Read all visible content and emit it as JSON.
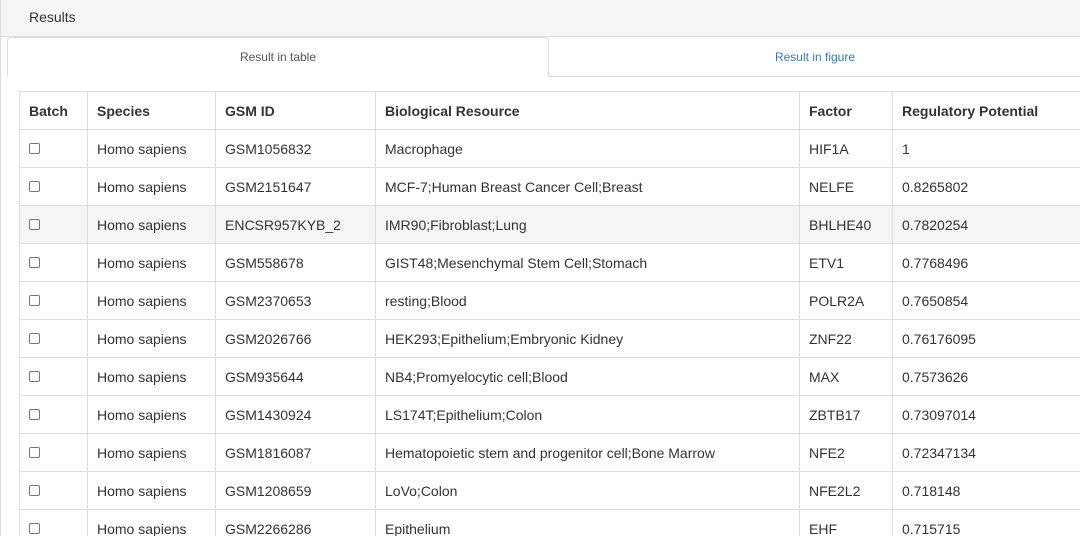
{
  "panel": {
    "heading": "Results"
  },
  "tabs": [
    {
      "label": "Result in table",
      "active": true
    },
    {
      "label": "Result in figure",
      "active": false
    }
  ],
  "colors": {
    "link": "#337ab7",
    "border": "#dddddd",
    "heading_bg": "#f5f5f5",
    "row_hover": "#f5f5f5"
  },
  "table": {
    "columns": [
      "Batch",
      "Species",
      "GSM ID",
      "Biological Resource",
      "Factor",
      "Regulatory Potential"
    ],
    "rows": [
      {
        "species": "Homo sapiens",
        "gsm": "GSM1056832",
        "resource": "Macrophage",
        "factor": "HIF1A",
        "potential": "1"
      },
      {
        "species": "Homo sapiens",
        "gsm": "GSM2151647",
        "resource": "MCF-7;Human Breast Cancer Cell;Breast",
        "factor": "NELFE",
        "potential": "0.8265802"
      },
      {
        "species": "Homo sapiens",
        "gsm": "ENCSR957KYB_2",
        "resource": "IMR90;Fibroblast;Lung",
        "factor": "BHLHE40",
        "potential": "0.7820254"
      },
      {
        "species": "Homo sapiens",
        "gsm": "GSM558678",
        "resource": "GIST48;Mesenchymal Stem Cell;Stomach",
        "factor": "ETV1",
        "potential": "0.7768496"
      },
      {
        "species": "Homo sapiens",
        "gsm": "GSM2370653",
        "resource": "resting;Blood",
        "factor": "POLR2A",
        "potential": "0.7650854"
      },
      {
        "species": "Homo sapiens",
        "gsm": "GSM2026766",
        "resource": "HEK293;Epithelium;Embryonic Kidney",
        "factor": "ZNF22",
        "potential": "0.76176095"
      },
      {
        "species": "Homo sapiens",
        "gsm": "GSM935644",
        "resource": "NB4;Promyelocytic cell;Blood",
        "factor": "MAX",
        "potential": "0.7573626"
      },
      {
        "species": "Homo sapiens",
        "gsm": "GSM1430924",
        "resource": "LS174T;Epithelium;Colon",
        "factor": "ZBTB17",
        "potential": "0.73097014"
      },
      {
        "species": "Homo sapiens",
        "gsm": "GSM1816087",
        "resource": "Hematopoietic stem and progenitor cell;Bone Marrow",
        "factor": "NFE2",
        "potential": "0.72347134"
      },
      {
        "species": "Homo sapiens",
        "gsm": "GSM1208659",
        "resource": "LoVo;Colon",
        "factor": "NFE2L2",
        "potential": "0.718148"
      },
      {
        "species": "Homo sapiens",
        "gsm": "GSM2266286",
        "resource": "Epithelium",
        "factor": "EHF",
        "potential": "0.715715"
      }
    ]
  }
}
